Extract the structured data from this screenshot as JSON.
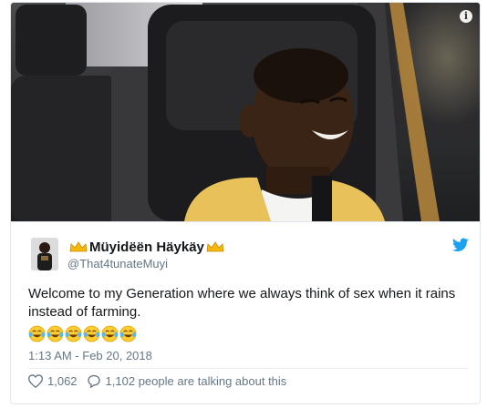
{
  "media": {
    "info_icon": "info-icon",
    "image": "child-in-car-seat-laughing"
  },
  "author": {
    "name": "Müyidëën Häykäy",
    "handle": "@That4tunateMuyi",
    "crown_icon": "crown-icon",
    "verified_badge": false
  },
  "tweet": {
    "text": "Welcome to my Generation where we always think of sex when it rains instead of farming.",
    "emojis": [
      "😂",
      "😂",
      "😂",
      "😂",
      "😂",
      "😂"
    ],
    "timestamp": "1:13 AM - Feb 20, 2018"
  },
  "actions": {
    "likes": "1,062",
    "talking": "1,102 people are talking about this"
  },
  "colors": {
    "twitter_blue": "#1da1f2",
    "secondary_text": "#657786",
    "border": "#e1e8ed",
    "sweater": "#e8c15a"
  }
}
